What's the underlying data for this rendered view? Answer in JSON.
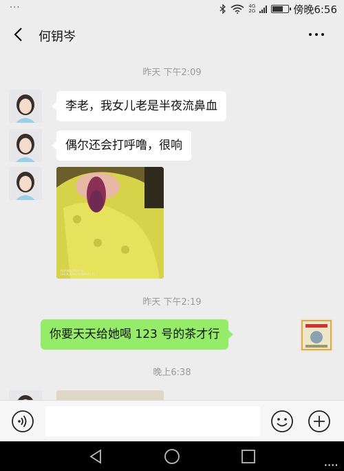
{
  "status_bar": {
    "left_dots": "···",
    "network_4g": "4G",
    "network_2g": "2G",
    "battery_level": 0.6,
    "time": "傍晚6:56"
  },
  "header": {
    "title": "何钥岑",
    "back_icon": "chevron-left-icon",
    "more_icon": "more-dots-icon"
  },
  "messages": {
    "ts1": "昨天 下午2:09",
    "m1": "李老，我女儿老是半夜流鼻血",
    "m2": "偶尔还会打呼噜，很响",
    "photo_watermark_1": "HUAWEI P10 Plus",
    "photo_watermark_2": "LEICA DUAL CAMERA | H",
    "ts2": "昨天 下午2:19",
    "m4": "你要天天给她喝 123 号的茶才行",
    "ts3": "晚上6:38"
  },
  "input_bar": {
    "value": "",
    "voice_icon": "voice-icon",
    "emoji_icon": "emoji-icon",
    "plus_icon": "plus-icon"
  },
  "system_nav": {
    "dots": "····"
  },
  "colors": {
    "background": "#ededed",
    "my_bubble": "#95ec69",
    "their_bubble": "#ffffff",
    "timestamp": "#9a9a9a"
  }
}
